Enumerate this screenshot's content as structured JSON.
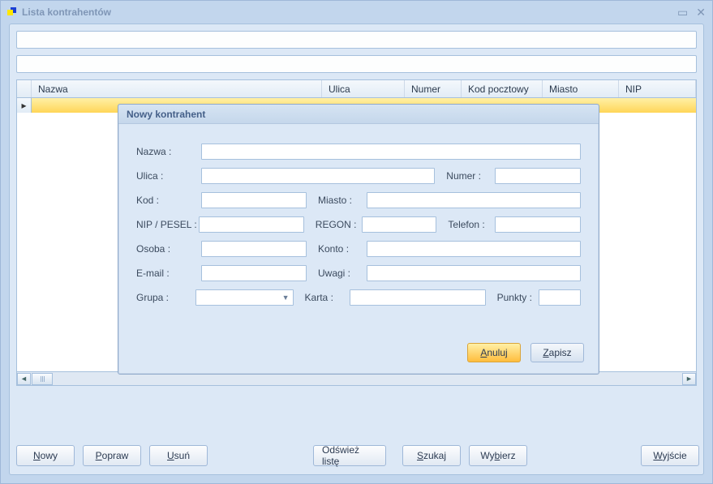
{
  "window": {
    "title": "Lista kontrahentów"
  },
  "table": {
    "columns": {
      "nazwa": "Nazwa",
      "ulica": "Ulica",
      "numer": "Numer",
      "kod": "Kod pocztowy",
      "miasto": "Miasto",
      "nip": "NIP"
    }
  },
  "toolbar": {
    "nowy": "Nowy",
    "popraw": "Popraw",
    "usun": "Usuń",
    "odswiez": "Odśwież listę",
    "szukaj": "Szukaj",
    "wybierz": "Wybierz",
    "wyjscie": "Wyjście"
  },
  "dialog": {
    "title": "Nowy kontrahent",
    "labels": {
      "nazwa": "Nazwa :",
      "ulica": "Ulica :",
      "numer": "Numer :",
      "kod": "Kod :",
      "miasto": "Miasto :",
      "nip": "NIP / PESEL :",
      "regon": "REGON :",
      "telefon": "Telefon :",
      "osoba": "Osoba :",
      "konto": "Konto :",
      "email": "E-mail :",
      "uwagi": "Uwagi :",
      "grupa": "Grupa :",
      "karta": "Karta :",
      "punkty": "Punkty :"
    },
    "buttons": {
      "anuluj": "Anuluj",
      "zapisz": "Zapisz"
    }
  }
}
